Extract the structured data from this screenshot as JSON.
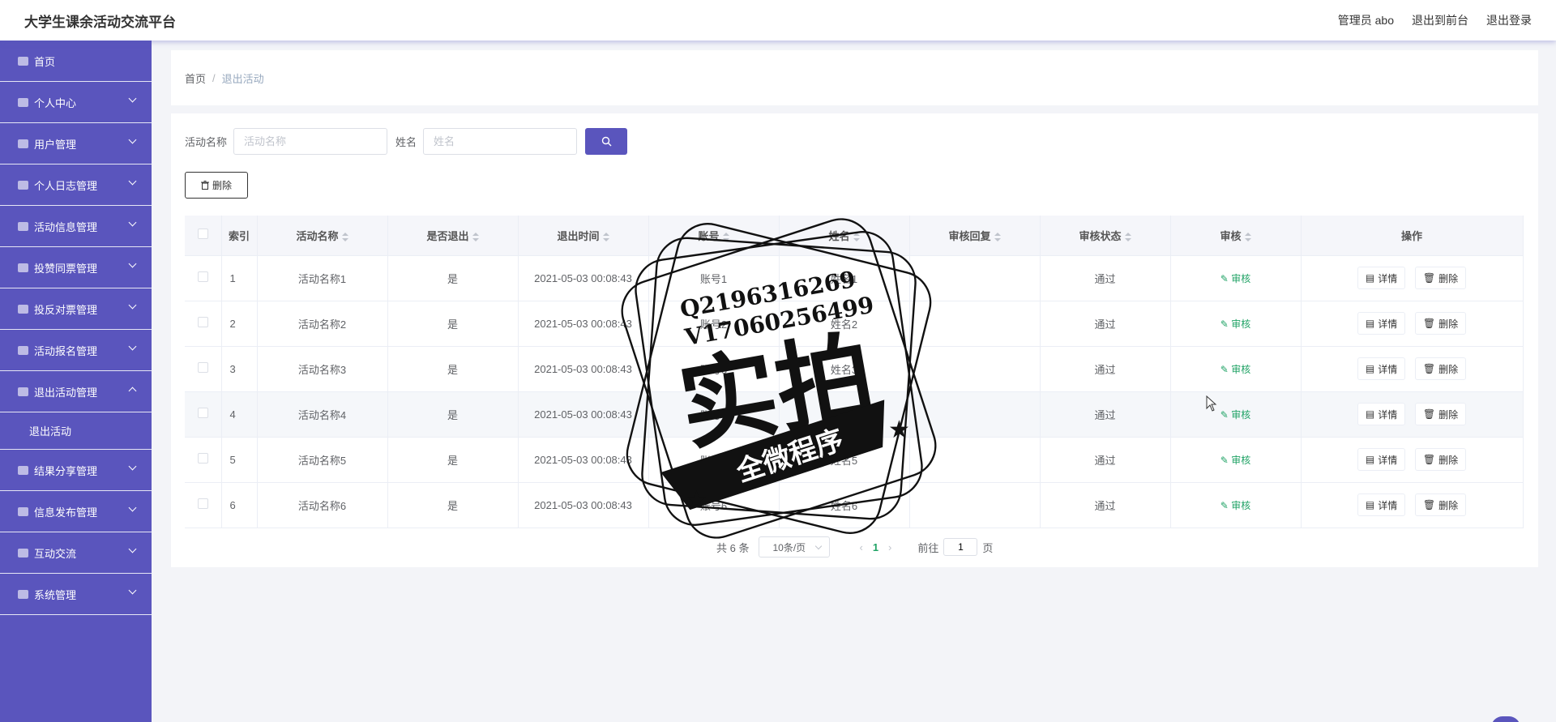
{
  "app_title": "大学生课余活动交流平台",
  "header": {
    "user": "管理员 abo",
    "to_front": "退出到前台",
    "logout": "退出登录"
  },
  "sidebar": {
    "items": [
      {
        "label": "首页",
        "icon": "home-icon",
        "expandable": false
      },
      {
        "label": "个人中心",
        "icon": "user-icon",
        "expandable": true
      },
      {
        "label": "用户管理",
        "icon": "users-icon",
        "expandable": true
      },
      {
        "label": "个人日志管理",
        "icon": "log-icon",
        "expandable": true
      },
      {
        "label": "活动信息管理",
        "icon": "activity-icon",
        "expandable": true
      },
      {
        "label": "投赞同票管理",
        "icon": "vote-icon",
        "expandable": true
      },
      {
        "label": "投反对票管理",
        "icon": "oppose-icon",
        "expandable": true
      },
      {
        "label": "活动报名管理",
        "icon": "signup-icon",
        "expandable": true
      },
      {
        "label": "退出活动管理",
        "icon": "grid-icon",
        "expandable": true,
        "expanded": true,
        "children": [
          "退出活动"
        ]
      },
      {
        "label": "结果分享管理",
        "icon": "share-icon",
        "expandable": true
      },
      {
        "label": "信息发布管理",
        "icon": "publish-icon",
        "expandable": true
      },
      {
        "label": "互动交流",
        "icon": "chat-icon",
        "expandable": true
      },
      {
        "label": "系统管理",
        "icon": "system-icon",
        "expandable": true
      }
    ]
  },
  "breadcrumb": {
    "home": "首页",
    "separator": "/",
    "current": "退出活动"
  },
  "search": {
    "activity_label": "活动名称",
    "activity_placeholder": "活动名称",
    "name_label": "姓名",
    "name_placeholder": "姓名"
  },
  "toolbar": {
    "delete_label": "删除"
  },
  "table": {
    "columns": [
      "索引",
      "活动名称",
      "是否退出",
      "退出时间",
      "账号",
      "姓名",
      "审核回复",
      "审核状态",
      "审核",
      "操作"
    ],
    "rows": [
      {
        "index": "1",
        "activity": "活动名称1",
        "quit": "是",
        "time": "2021-05-03 00:08:43",
        "account": "账号1",
        "name": "姓名1",
        "reply": "",
        "status": "通过"
      },
      {
        "index": "2",
        "activity": "活动名称2",
        "quit": "是",
        "time": "2021-05-03 00:08:43",
        "account": "账号2",
        "name": "姓名2",
        "reply": "",
        "status": "通过"
      },
      {
        "index": "3",
        "activity": "活动名称3",
        "quit": "是",
        "time": "2021-05-03 00:08:43",
        "account": "账号3",
        "name": "姓名3",
        "reply": "",
        "status": "通过"
      },
      {
        "index": "4",
        "activity": "活动名称4",
        "quit": "是",
        "time": "2021-05-03 00:08:43",
        "account": "账号4",
        "name": "姓名4",
        "reply": "",
        "status": "通过"
      },
      {
        "index": "5",
        "activity": "活动名称5",
        "quit": "是",
        "time": "2021-05-03 00:08:43",
        "account": "账号5",
        "name": "姓名5",
        "reply": "",
        "status": "通过"
      },
      {
        "index": "6",
        "activity": "活动名称6",
        "quit": "是",
        "time": "2021-05-03 00:08:43",
        "account": "账号6",
        "name": "姓名6",
        "reply": "",
        "status": "通过"
      }
    ],
    "audit_label": "审核",
    "detail_label": "详情",
    "delete_label": "删除"
  },
  "pagination": {
    "total": "共 6 条",
    "page_size": "10条/页",
    "current_page": "1",
    "goto_prefix": "前往",
    "goto_value": "1",
    "goto_suffix": "页"
  },
  "watermark": {
    "line1": "Q2196316269",
    "line2": "V17060256499",
    "main": "实拍",
    "banner": "全微程序"
  },
  "colors": {
    "accent": "#5a55bd",
    "success": "#21a366"
  }
}
